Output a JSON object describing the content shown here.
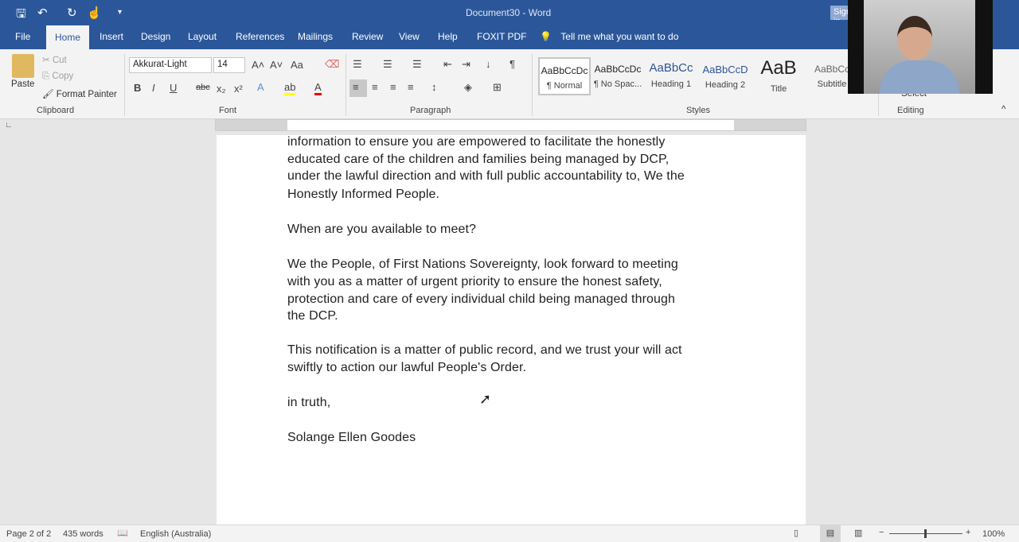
{
  "window": {
    "title": "Document30 - Word",
    "signin": "Sign in"
  },
  "tabs": [
    {
      "label": "File"
    },
    {
      "label": "Home"
    },
    {
      "label": "Insert"
    },
    {
      "label": "Design"
    },
    {
      "label": "Layout"
    },
    {
      "label": "References"
    },
    {
      "label": "Mailings"
    },
    {
      "label": "Review"
    },
    {
      "label": "View"
    },
    {
      "label": "Help"
    },
    {
      "label": "FOXIT PDF"
    }
  ],
  "tell_me": "Tell me what you want to do",
  "clipboard": {
    "paste": "Paste",
    "cut": "Cut",
    "copy": "Copy",
    "format_painter": "Format Painter",
    "label": "Clipboard"
  },
  "font": {
    "name": "Akkurat-Light",
    "size": "14",
    "label": "Font",
    "case": "Aa"
  },
  "paragraph": {
    "label": "Paragraph"
  },
  "styles": {
    "label": "Styles",
    "items": [
      {
        "preview": "AaBbCcDc",
        "name": "¶ Normal"
      },
      {
        "preview": "AaBbCcDc",
        "name": "¶ No Spac..."
      },
      {
        "preview": "AaBbCc",
        "name": "Heading 1"
      },
      {
        "preview": "AaBbCcD",
        "name": "Heading 2"
      },
      {
        "preview": "AaB",
        "name": "Title"
      },
      {
        "preview": "AaBbCc",
        "name": "Subtitle"
      }
    ]
  },
  "editing": {
    "label": "Editing",
    "select": "Select"
  },
  "document": {
    "lines": [
      "information to ensure you are empowered to facilitate the honestly",
      "educated care of the children and families being managed by DCP,",
      "under the lawful direction and with full public accountability to, We the",
      "Honestly Informed People.",
      "When are you available to meet?",
      "We the People, of First Nations Sovereignty, look forward to meeting",
      "with you as a matter of urgent priority to ensure the honest safety,",
      "protection and care of every individual child being managed through",
      "the DCP.",
      "This notification is a matter of public record, and we trust your will act",
      "swiftly to action our lawful People's Order.",
      "in truth,",
      "Solange Ellen Goodes"
    ]
  },
  "status": {
    "page": "Page 2 of 2",
    "words": "435 words",
    "language": "English (Australia)",
    "zoom": "100%",
    "zoom_percent": 100
  },
  "colors": {
    "accent": "#2b579a",
    "ribbon": "#f3f3f3"
  }
}
